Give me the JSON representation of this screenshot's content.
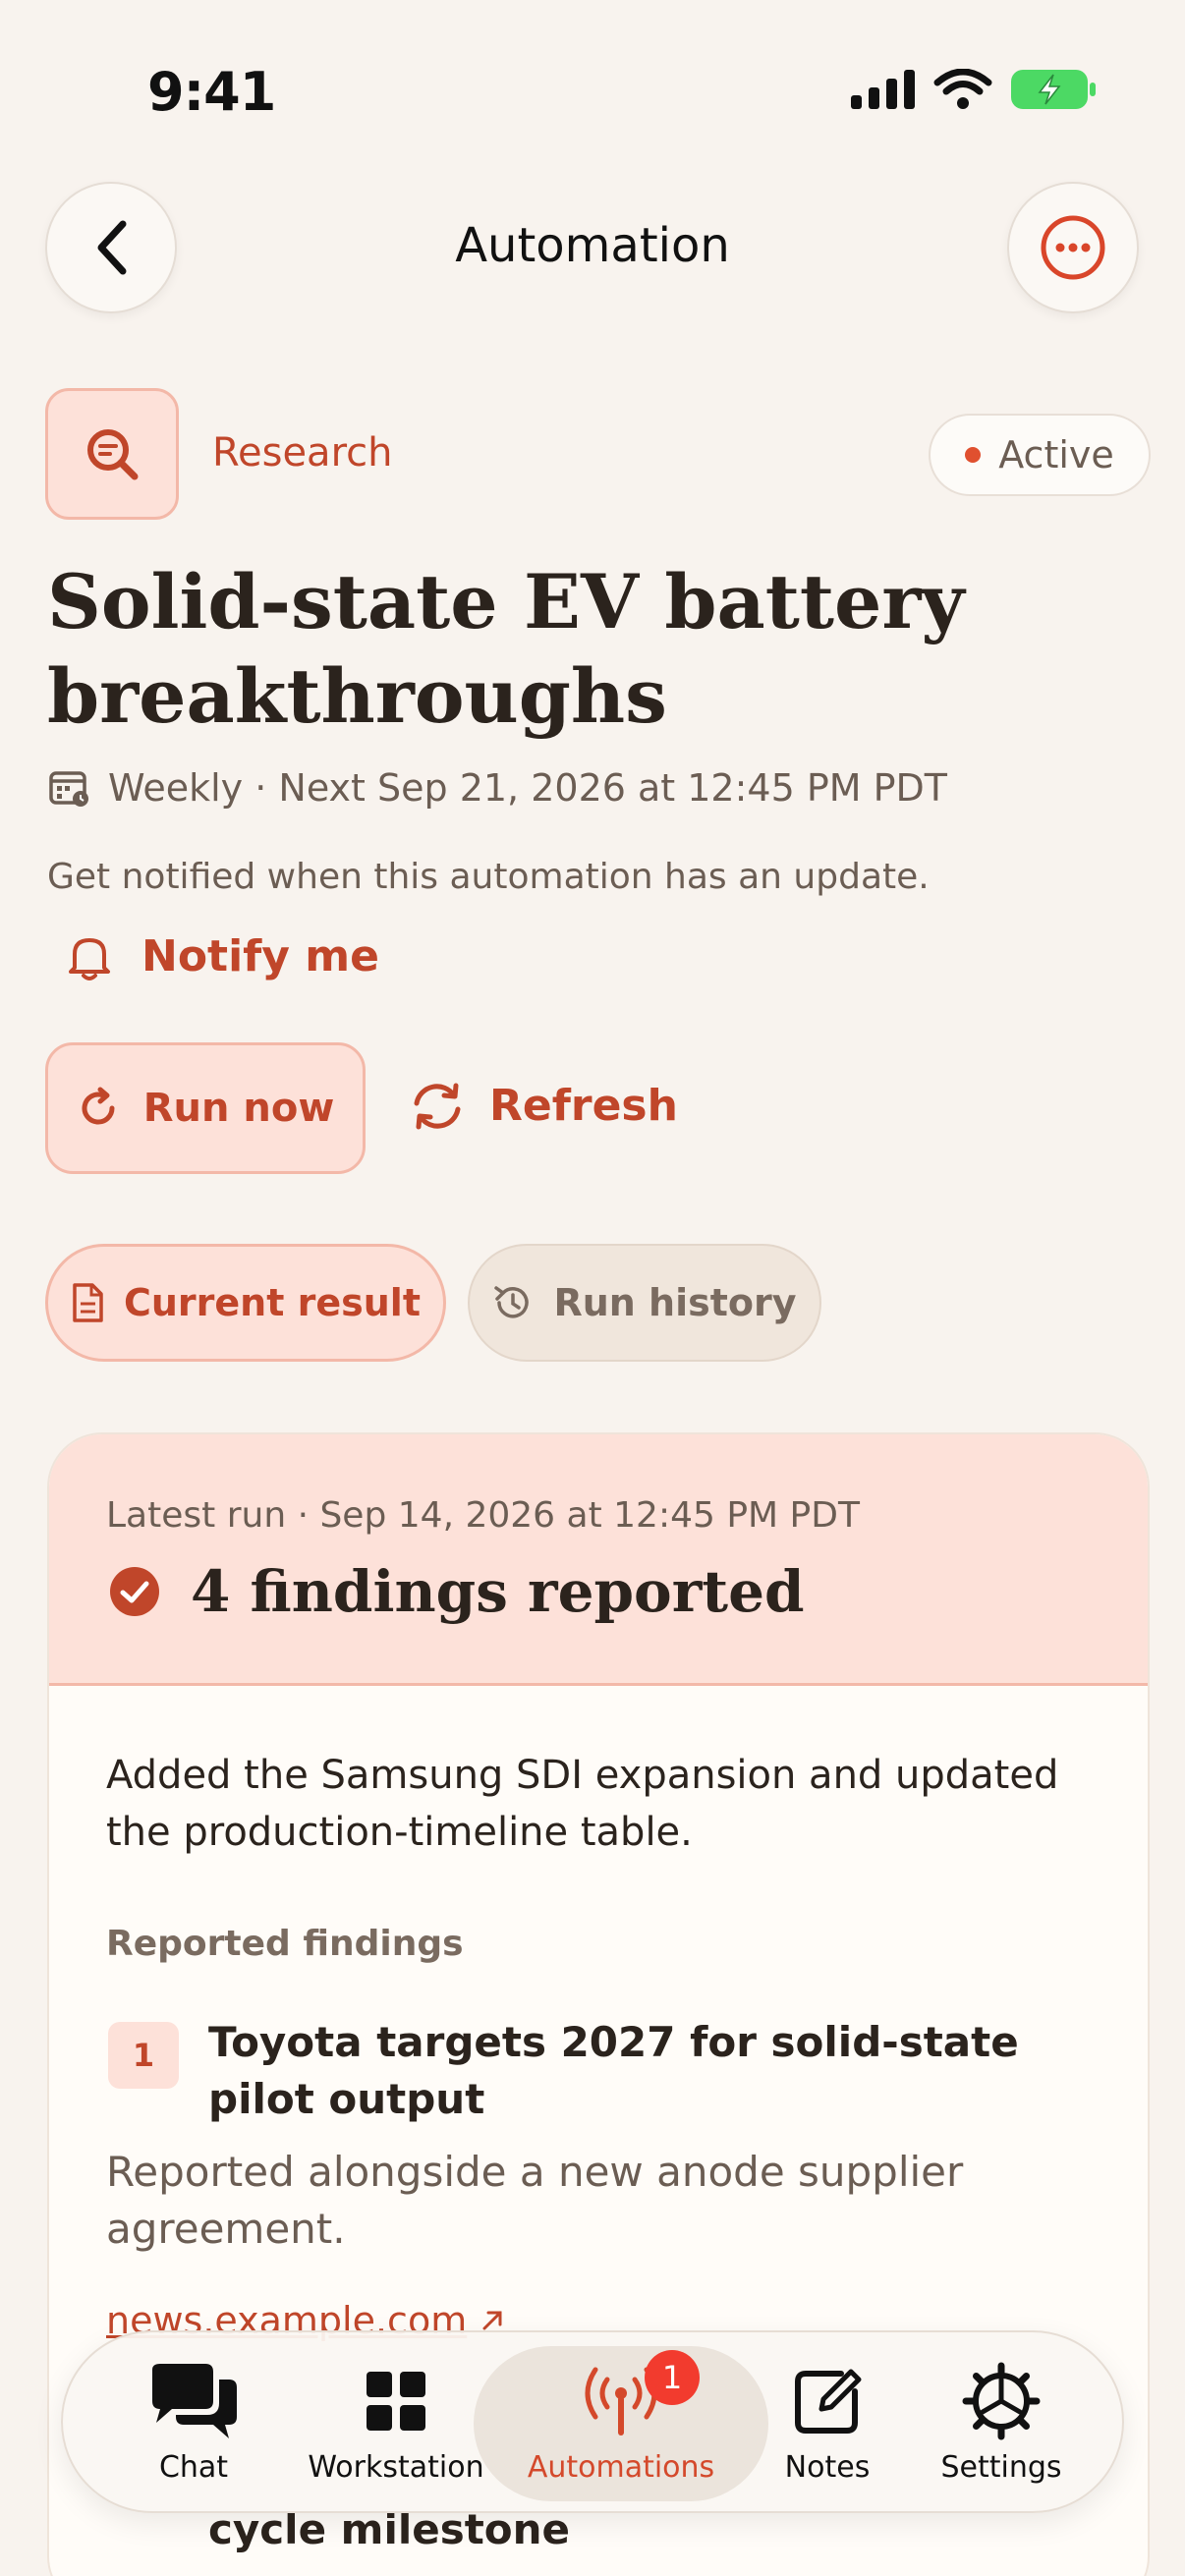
{
  "status_bar": {
    "time": "9:41"
  },
  "header": {
    "title": "Automation"
  },
  "automation": {
    "category": "Research",
    "status": "Active",
    "title": "Solid-state EV battery breakthroughs",
    "schedule": "Weekly · Next Sep 21, 2026 at 12:45 PM PDT",
    "notify_hint": "Get notified when this automation has an update.",
    "notify_label": "Notify me"
  },
  "actions": {
    "run_now": "Run now",
    "refresh": "Refresh"
  },
  "tabs": {
    "current": "Current result",
    "history": "Run history"
  },
  "result": {
    "latest_run": "Latest run · Sep 14, 2026 at 12:45 PM PDT",
    "findings_title": "4 findings reported",
    "summary": "Added the Samsung SDI expansion and updated the production-timeline table.",
    "section_label": "Reported findings",
    "findings": [
      {
        "num": "1",
        "title": "Toyota targets 2027 for solid-state pilot output",
        "desc": "Reported alongside a new anode supplier agreement.",
        "link": "news.example.com"
      },
      {
        "title": "cycle milestone"
      }
    ]
  },
  "tabbar": {
    "items": [
      {
        "label": "Chat",
        "icon": "chat-icon"
      },
      {
        "label": "Workstation",
        "icon": "grid-icon"
      },
      {
        "label": "Automations",
        "icon": "broadcast-icon",
        "badge": "1"
      },
      {
        "label": "Notes",
        "icon": "compose-icon"
      },
      {
        "label": "Settings",
        "icon": "gear-icon"
      }
    ]
  },
  "colors": {
    "accent": "#c0462a",
    "background": "#f8f3ee",
    "badge": "#f23b2e"
  }
}
